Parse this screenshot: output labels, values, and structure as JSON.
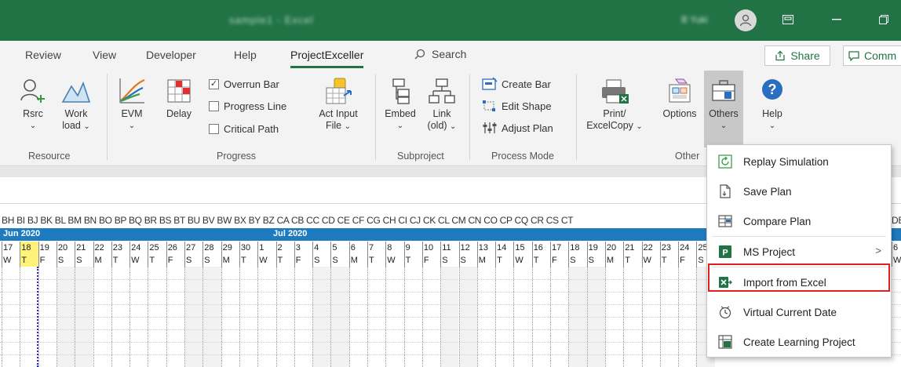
{
  "titlebar": {
    "doc_title": "sample1 - Excel",
    "user_name": "B Yuki",
    "avatar_icon": "person-icon",
    "buttons": [
      "ribbon-display-icon",
      "minimize-icon",
      "restore-icon"
    ]
  },
  "tabs": {
    "items": [
      "Review",
      "View",
      "Developer",
      "Help",
      "ProjectExceller"
    ],
    "active": "ProjectExceller",
    "search_label": "Search",
    "share_label": "Share",
    "comments_label": "Comm"
  },
  "ribbon": {
    "resource": {
      "rsrc_label": "Rsrc",
      "work_label_1": "Work",
      "work_label_2": "load",
      "group_label": "Resource"
    },
    "progress": {
      "evm_label": "EVM",
      "delay_label": "Delay",
      "checks": [
        {
          "label": "Overrun Bar",
          "checked": true
        },
        {
          "label": "Progress Line",
          "checked": false
        },
        {
          "label": "Critical Path",
          "checked": false
        }
      ],
      "act_input_1": "Act Input",
      "act_input_2": "File",
      "group_label": "Progress"
    },
    "subproject": {
      "embed_label": "Embed",
      "link_1": "Link",
      "link_2": "(old)",
      "group_label": "Subproject"
    },
    "process_mode": {
      "create_bar": "Create Bar",
      "edit_shape": "Edit Shape",
      "adjust_plan": "Adjust Plan",
      "group_label": "Process Mode"
    },
    "other": {
      "print_1": "Print/",
      "print_2": "ExcelCopy",
      "options_label": "Options",
      "others_label": "Others",
      "help_label": "Help",
      "group_label": "Other"
    }
  },
  "grid": {
    "column_headers": "BH BI BJ BK BL BM BN BO BP BQ BR BS BT BU BV BW BX BY BZ CA CB CC CD CE CF CG CH CI CJ CK CL CM CN CO CP CQ CR CS CT",
    "column_header_tail": "DE",
    "months": [
      "Jun 2020",
      "Jul 2020"
    ],
    "days": [
      "17",
      "18",
      "19",
      "20",
      "21",
      "22",
      "23",
      "24",
      "25",
      "26",
      "27",
      "28",
      "29",
      "30",
      "1",
      "2",
      "3",
      "4",
      "5",
      "6",
      "7",
      "8",
      "9",
      "10",
      "11",
      "12",
      "13",
      "14",
      "15",
      "16",
      "17",
      "18",
      "19",
      "20",
      "21",
      "22",
      "23",
      "24",
      "25"
    ],
    "weekdays": [
      "W",
      "T",
      "F",
      "S",
      "S",
      "M",
      "T",
      "W",
      "T",
      "F",
      "S",
      "S",
      "M",
      "T",
      "W",
      "T",
      "F",
      "S",
      "S",
      "M",
      "T",
      "W",
      "T",
      "F",
      "S",
      "S",
      "M",
      "T",
      "W",
      "T",
      "F",
      "S",
      "S",
      "M",
      "T",
      "W",
      "T",
      "F",
      "S"
    ],
    "tail_day": "6",
    "tail_weekday": "W",
    "today_day": "18"
  },
  "menu": {
    "items": [
      {
        "label": "Replay Simulation",
        "icon": "replay-icon"
      },
      {
        "label": "Save Plan",
        "icon": "save-plan-icon"
      },
      {
        "label": "Compare Plan",
        "icon": "compare-icon"
      },
      {
        "label": "MS Project",
        "icon": "ms-project-icon",
        "submenu": true
      },
      {
        "label": "Import from Excel",
        "icon": "excel-import-icon"
      },
      {
        "label": "Virtual Current Date",
        "icon": "clock-icon"
      },
      {
        "label": "Create Learning Project",
        "icon": "learning-project-icon"
      }
    ],
    "highlighted": "Import from Excel"
  },
  "colors": {
    "excel_green": "#217346",
    "month_bar": "#1f7bbf",
    "today_highlight": "#fff27a",
    "callout_red": "#e02020"
  }
}
